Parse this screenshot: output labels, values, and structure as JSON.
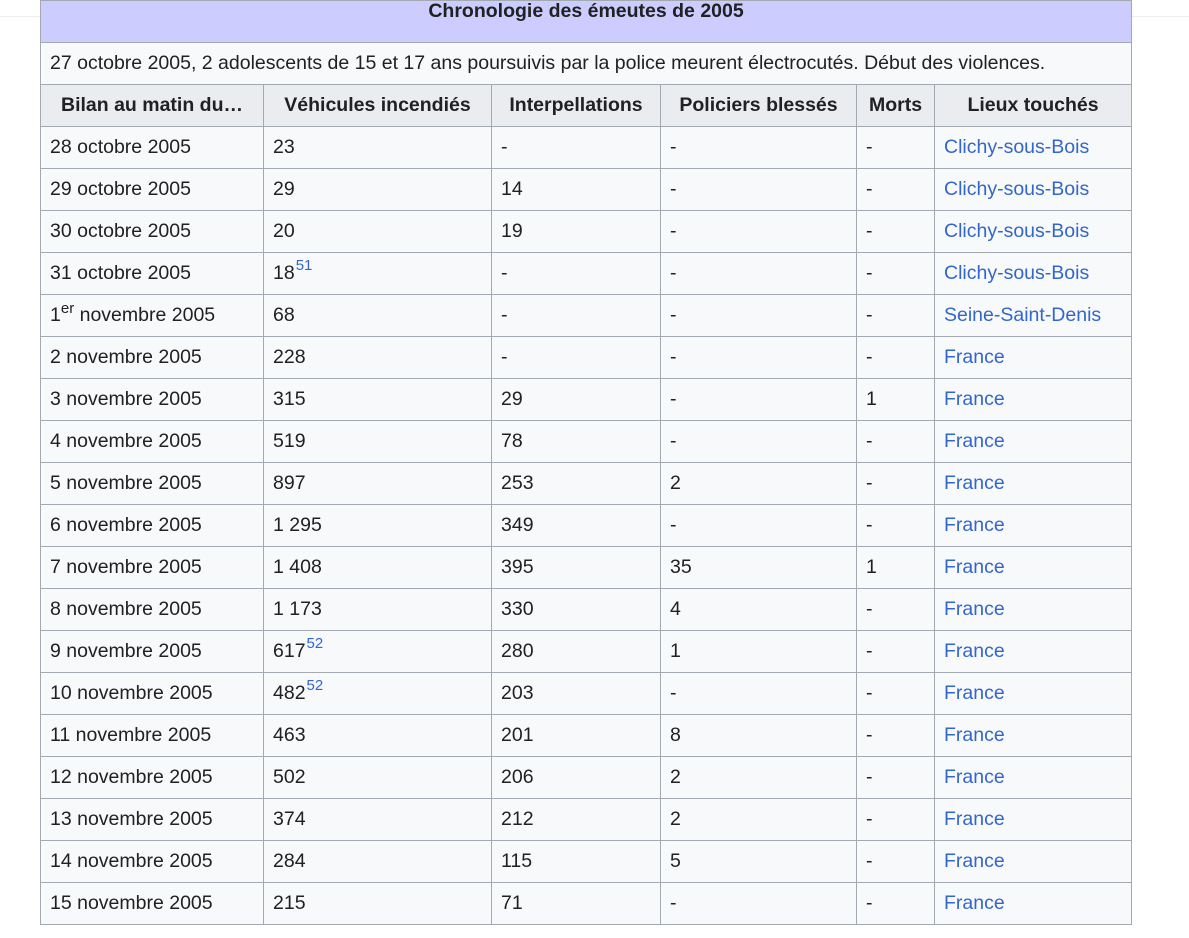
{
  "table": {
    "caption": "Chronologie des émeutes de 2005",
    "intro": "27 octobre 2005, 2 adolescents de 15 et 17 ans poursuivis par la police meurent électrocutés. Début des violences.",
    "headers": {
      "date": "Bilan au matin du…",
      "vehicules": "Véhicules incendiés",
      "interpellations": "Interpellations",
      "policiers": "Policiers blessés",
      "morts": "Morts",
      "lieux": "Lieux touchés"
    },
    "rows": [
      {
        "date": "28 octobre 2005",
        "vehicules": "23",
        "ref": "",
        "interpellations": "-",
        "policiers": "-",
        "morts": "-",
        "lieux": "Clichy-sous-Bois"
      },
      {
        "date": "29 octobre 2005",
        "vehicules": "29",
        "ref": "",
        "interpellations": "14",
        "policiers": "-",
        "morts": "-",
        "lieux": "Clichy-sous-Bois"
      },
      {
        "date": "30 octobre 2005",
        "vehicules": "20",
        "ref": "",
        "interpellations": "19",
        "policiers": "-",
        "morts": "-",
        "lieux": "Clichy-sous-Bois"
      },
      {
        "date": "31 octobre 2005",
        "vehicules": "18",
        "ref": "51",
        "interpellations": "-",
        "policiers": "-",
        "morts": "-",
        "lieux": "Clichy-sous-Bois"
      },
      {
        "date_pre": "1",
        "date_sup": "er",
        "date_post": " novembre 2005",
        "vehicules": "68",
        "ref": "",
        "interpellations": "-",
        "policiers": "-",
        "morts": "-",
        "lieux": "Seine-Saint-Denis"
      },
      {
        "date": "2 novembre 2005",
        "vehicules": "228",
        "ref": "",
        "interpellations": "-",
        "policiers": "-",
        "morts": "-",
        "lieux": "France"
      },
      {
        "date": "3 novembre 2005",
        "vehicules": "315",
        "ref": "",
        "interpellations": "29",
        "policiers": "-",
        "morts": "1",
        "lieux": "France"
      },
      {
        "date": "4 novembre 2005",
        "vehicules": "519",
        "ref": "",
        "interpellations": "78",
        "policiers": "-",
        "morts": "-",
        "lieux": "France"
      },
      {
        "date": "5 novembre 2005",
        "vehicules": "897",
        "ref": "",
        "interpellations": "253",
        "policiers": "2",
        "morts": "-",
        "lieux": "France"
      },
      {
        "date": "6 novembre 2005",
        "vehicules": "1 295",
        "ref": "",
        "interpellations": "349",
        "policiers": "-",
        "morts": "-",
        "lieux": "France"
      },
      {
        "date": "7 novembre 2005",
        "vehicules": "1 408",
        "ref": "",
        "interpellations": "395",
        "policiers": "35",
        "morts": "1",
        "lieux": "France"
      },
      {
        "date": "8 novembre 2005",
        "vehicules": "1 173",
        "ref": "",
        "interpellations": "330",
        "policiers": "4",
        "morts": "-",
        "lieux": "France"
      },
      {
        "date": "9 novembre 2005",
        "vehicules": "617",
        "ref": "52",
        "interpellations": "280",
        "policiers": "1",
        "morts": "-",
        "lieux": "France"
      },
      {
        "date": "10 novembre 2005",
        "vehicules": "482",
        "ref": "52",
        "interpellations": "203",
        "policiers": "-",
        "morts": "-",
        "lieux": "France"
      },
      {
        "date": "11 novembre 2005",
        "vehicules": "463",
        "ref": "",
        "interpellations": "201",
        "policiers": "8",
        "morts": "-",
        "lieux": "France"
      },
      {
        "date": "12 novembre 2005",
        "vehicules": "502",
        "ref": "",
        "interpellations": "206",
        "policiers": "2",
        "morts": "-",
        "lieux": "France"
      },
      {
        "date": "13 novembre 2005",
        "vehicules": "374",
        "ref": "",
        "interpellations": "212",
        "policiers": "2",
        "morts": "-",
        "lieux": "France"
      },
      {
        "date": "14 novembre 2005",
        "vehicules": "284",
        "ref": "",
        "interpellations": "115",
        "policiers": "5",
        "morts": "-",
        "lieux": "France"
      },
      {
        "date": "15 novembre 2005",
        "vehicules": "215",
        "ref": "",
        "interpellations": "71",
        "policiers": "-",
        "morts": "-",
        "lieux": "France"
      }
    ]
  },
  "colors": {
    "caption_bg": "#ccccff",
    "header_bg": "#eaecf0",
    "cell_bg": "#f8f9fa",
    "border": "#a2a9b1",
    "link": "#3366cc",
    "text": "#202122"
  }
}
